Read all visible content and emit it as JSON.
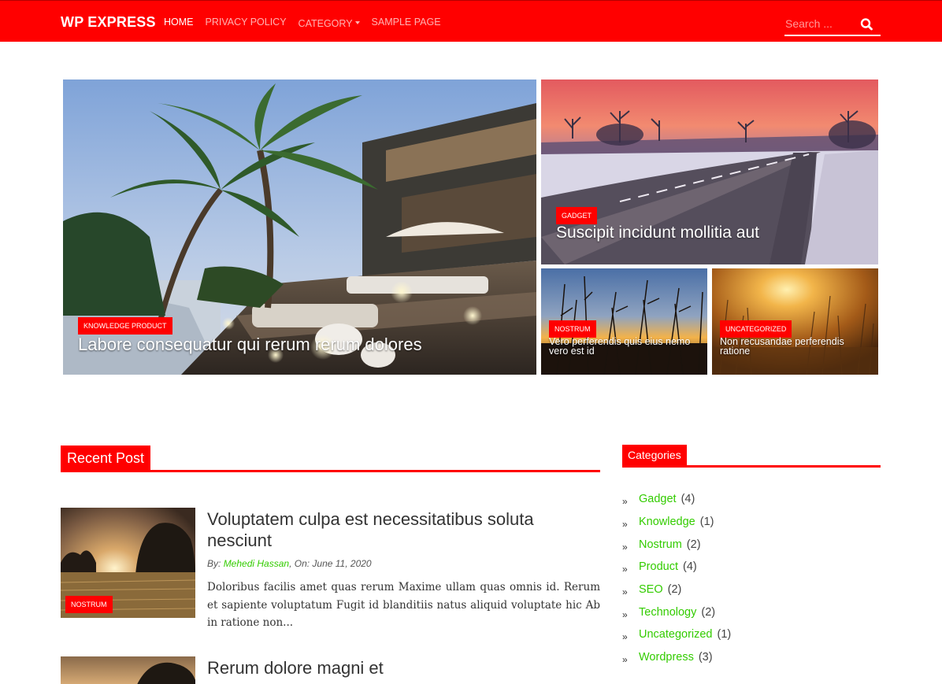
{
  "brand": "WP EXPRESS",
  "nav": {
    "items": [
      {
        "label": "HOME",
        "active": true
      },
      {
        "label": "PRIVACY POLICY",
        "active": false
      },
      {
        "label": "CATEGORY",
        "active": false,
        "has_dropdown": true
      },
      {
        "label": "SAMPLE PAGE",
        "active": false
      }
    ]
  },
  "search": {
    "placeholder": "Search ...",
    "icon": "search-icon"
  },
  "featured": [
    {
      "badge": "KNOWLEDGE PRODUCT",
      "title": "Labore consequatur qui rerum rerum dolores"
    },
    {
      "badge": "GADGET",
      "title": "Suscipit incidunt mollitia aut"
    },
    {
      "badge": "NOSTRUM",
      "title": "Vero perferendis quis eius nemo vero est id"
    },
    {
      "badge": "UNCATEGORIZED",
      "title": "Non recusandae perferendis ratione"
    }
  ],
  "recent": {
    "heading": "Recent Post",
    "posts": [
      {
        "title": "Voluptatem culpa est necessitatibus soluta nesciunt",
        "badge": "NOSTRUM",
        "meta_by": "By:",
        "author": "Mehedi Hassan",
        "meta_on": ", On: June 11, 2020",
        "excerpt": "Doloribus facilis amet quas rerum Maxime ullam quas omnis id. Rerum et sapiente voluptatum Fugit id blanditiis natus aliquid voluptate hic Ab in ratione non..."
      },
      {
        "title": "Rerum dolore magni et"
      }
    ]
  },
  "categories": {
    "heading": "Categories",
    "items": [
      {
        "name": "Gadget",
        "count": "(4)"
      },
      {
        "name": "Knowledge",
        "count": "(1)"
      },
      {
        "name": "Nostrum",
        "count": "(2)"
      },
      {
        "name": "Product",
        "count": "(4)"
      },
      {
        "name": "SEO",
        "count": "(2)"
      },
      {
        "name": "Technology",
        "count": "(2)"
      },
      {
        "name": "Uncategorized",
        "count": "(1)"
      },
      {
        "name": "Wordpress",
        "count": "(3)"
      }
    ]
  },
  "colors": {
    "brand_red": "#ff0000",
    "link_green": "#33cc00"
  }
}
